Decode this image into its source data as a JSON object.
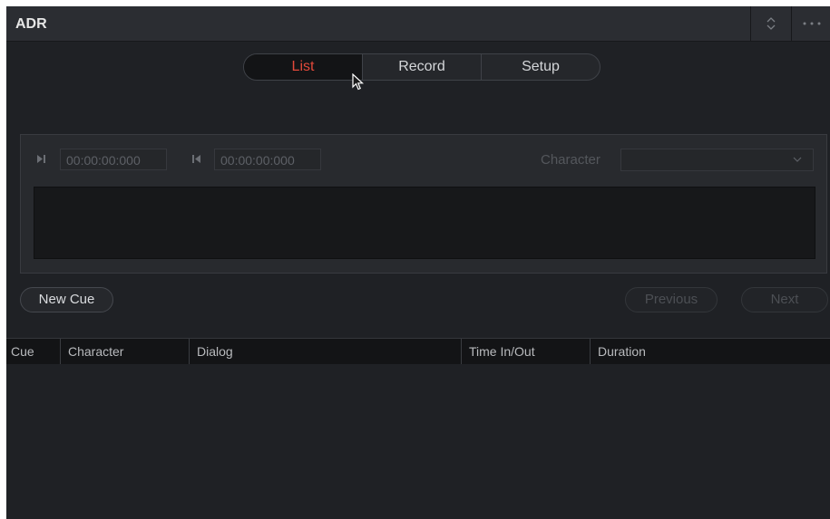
{
  "window": {
    "title": "ADR"
  },
  "titlebar": {
    "expand_icon": "expand-collapse-icon",
    "more_icon": "more-options-icon"
  },
  "tabs": [
    {
      "label": "List",
      "active": true
    },
    {
      "label": "Record",
      "active": false
    },
    {
      "label": "Setup",
      "active": false
    }
  ],
  "cue_editor": {
    "timecode_in": "00:00:00:000",
    "timecode_out": "00:00:00:000",
    "character_label": "Character",
    "character_value": "",
    "dialog_text": ""
  },
  "buttons": {
    "new_cue": "New Cue",
    "previous": "Previous",
    "next": "Next"
  },
  "table": {
    "columns": [
      "Cue",
      "Character",
      "Dialog",
      "Time In/Out",
      "Duration"
    ],
    "rows": []
  },
  "colors": {
    "accent_active_tab": "#e2493a",
    "panel_bg": "#1f2125",
    "titlebar_bg": "#2b2d32"
  }
}
